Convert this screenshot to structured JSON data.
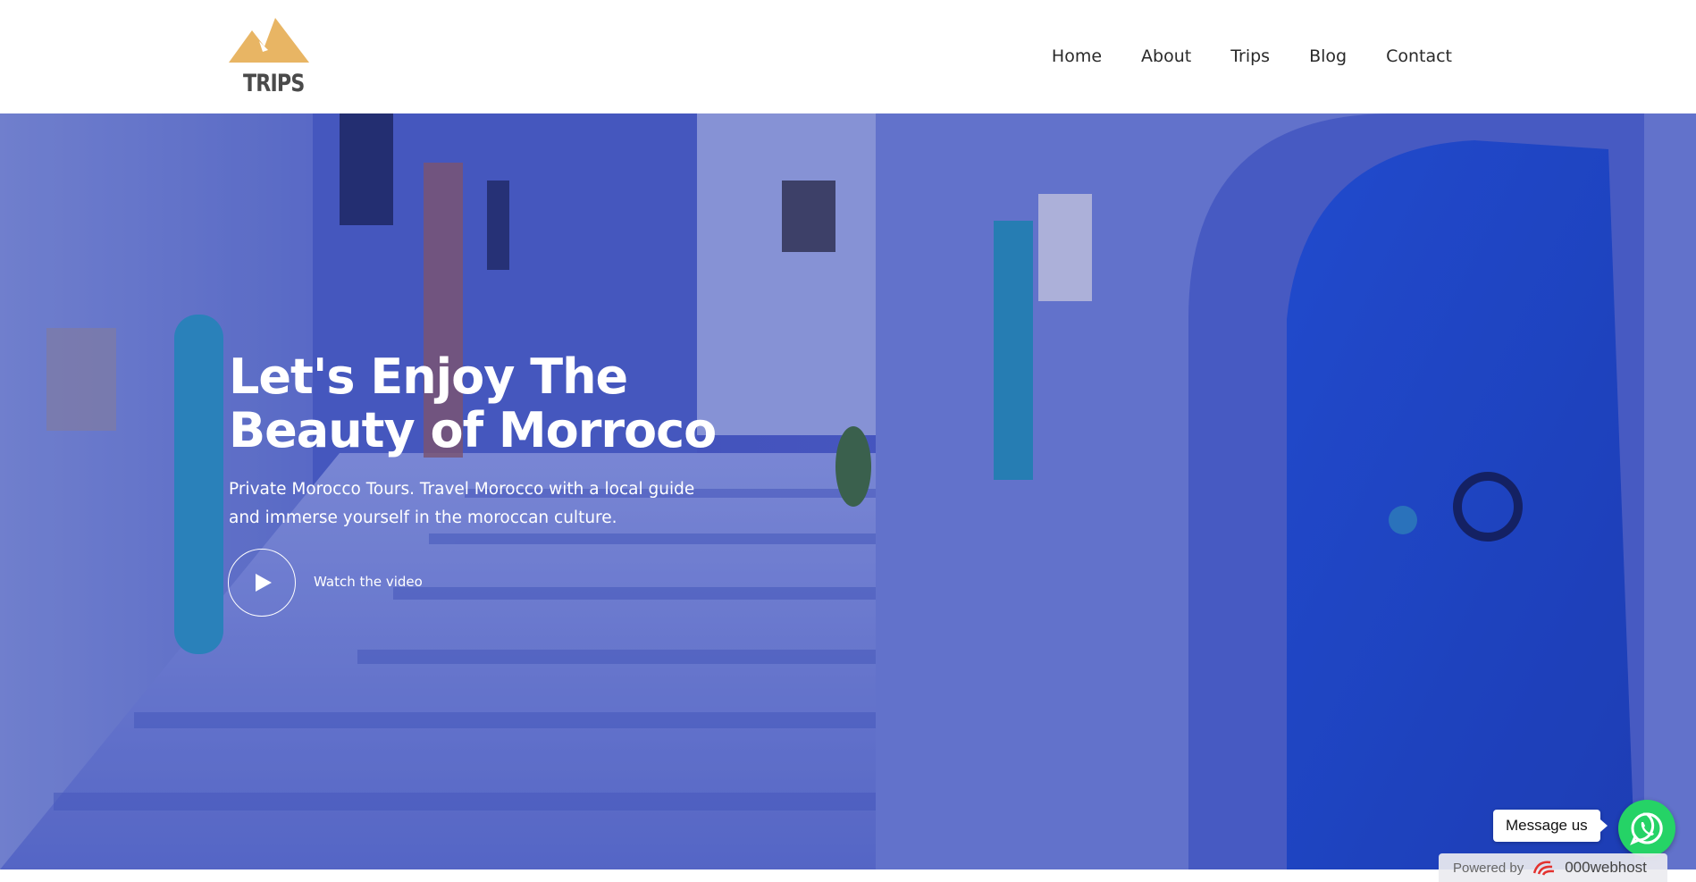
{
  "header": {
    "logo_text": "TRIPS",
    "nav": [
      {
        "label": "Home"
      },
      {
        "label": "About"
      },
      {
        "label": "Trips"
      },
      {
        "label": "Blog"
      },
      {
        "label": "Contact"
      }
    ]
  },
  "hero": {
    "title_line1": "Let's Enjoy The",
    "title_line2": "Beauty of Morroco",
    "subtitle": "Private Morocco Tours. Travel Morocco with a local guide and immerse yourself in the moroccan culture.",
    "watch_label": "Watch the video"
  },
  "widgets": {
    "message_label": "Message us",
    "powered_by": "Powered by",
    "host_name": "000webhost"
  },
  "colors": {
    "logo_accent": "#e8b564",
    "logo_text": "#4a4a4a",
    "whatsapp_green": "#25d366",
    "hero_blue": "#4a5dc7"
  }
}
